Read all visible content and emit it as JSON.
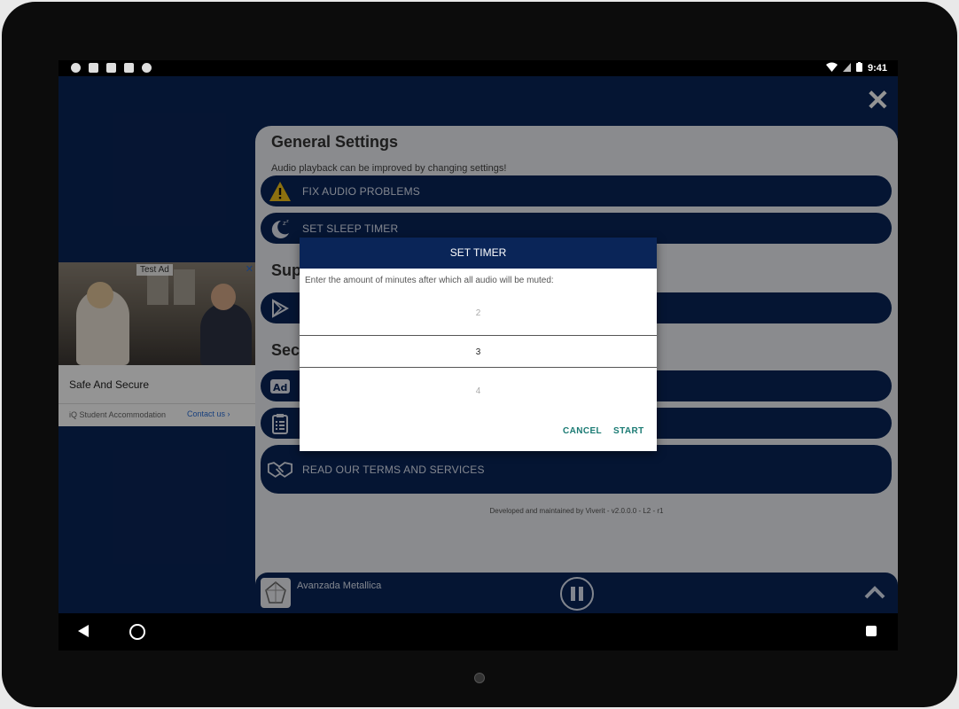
{
  "status_bar": {
    "time": "9:41"
  },
  "panel": {
    "title": "General Settings",
    "subtitle": "Audio playback can be improved by changing settings!",
    "section_support": "Sup",
    "section_security": "Secu",
    "items": [
      {
        "label": "FIX AUDIO PROBLEMS",
        "icon": "warning-icon"
      },
      {
        "label": "SET SLEEP TIMER",
        "icon": "sleep-moon-icon"
      },
      {
        "label": "",
        "icon": "play-store-icon"
      },
      {
        "label": "",
        "icon": "ad-icon"
      },
      {
        "label": "",
        "icon": "clipboard-icon"
      },
      {
        "label": "READ OUR TERMS AND SERVICES",
        "icon": "handshake-icon"
      }
    ],
    "footer": "Developed and maintained by Viverit - v2.0.0.0 - L2 - r1"
  },
  "ad": {
    "tag": "Test Ad",
    "headline": "Safe And Secure",
    "advertiser": "iQ Student Accommodation",
    "cta": "Contact us"
  },
  "player": {
    "track": "Avanzada Metallica"
  },
  "dialog": {
    "title": "SET TIMER",
    "message": "Enter the amount of minutes after which all audio will be muted:",
    "picker": {
      "prev": "2",
      "selected": "3",
      "next": "4"
    },
    "cancel": "CANCEL",
    "start": "START"
  },
  "colors": {
    "primary": "#0a2558",
    "panel_bg": "#eef0f4",
    "button_text": "#1a7a73"
  }
}
